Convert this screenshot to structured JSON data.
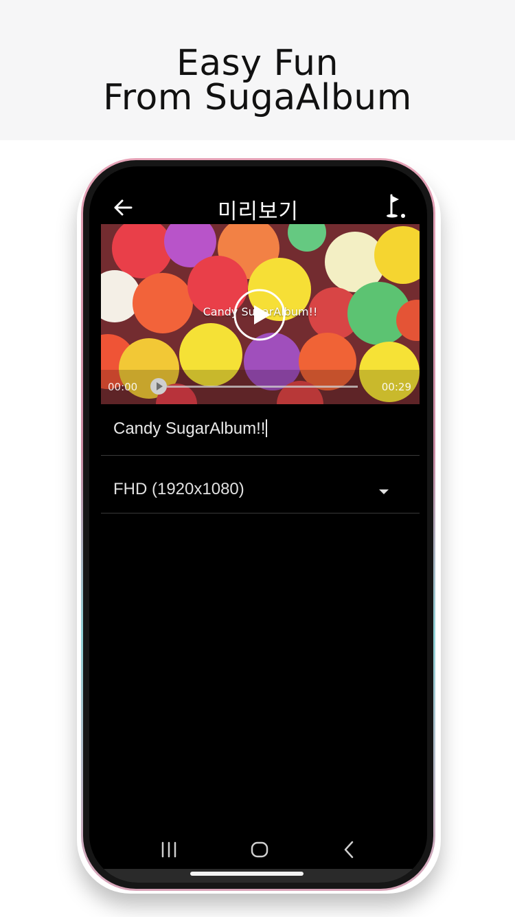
{
  "banner": {
    "line1": "Easy Fun",
    "line2": "From SugaAlbum"
  },
  "app_bar": {
    "title": "미리보기",
    "back_icon": "arrow-left-icon",
    "flag_icon": "golf-flag-icon"
  },
  "video": {
    "caption": "Candy SugarAlbum!!",
    "time_start": "00:00",
    "time_end": "00:29",
    "progress": 0.0,
    "play_icon": "play-circle-icon"
  },
  "form": {
    "title_value": "Candy SugarAlbum!!",
    "resolution_value": "FHD (1920x1080)",
    "dropdown_icon": "caret-down-icon"
  },
  "nav": {
    "recent_icon": "recent-apps-icon",
    "home_icon": "home-icon",
    "back_icon": "chevron-left-icon"
  },
  "colors": {
    "banner_bg": "#f6f6f7",
    "screen_bg": "#000000",
    "divider": "#3a3a3a",
    "text": "#e8e8e8"
  }
}
